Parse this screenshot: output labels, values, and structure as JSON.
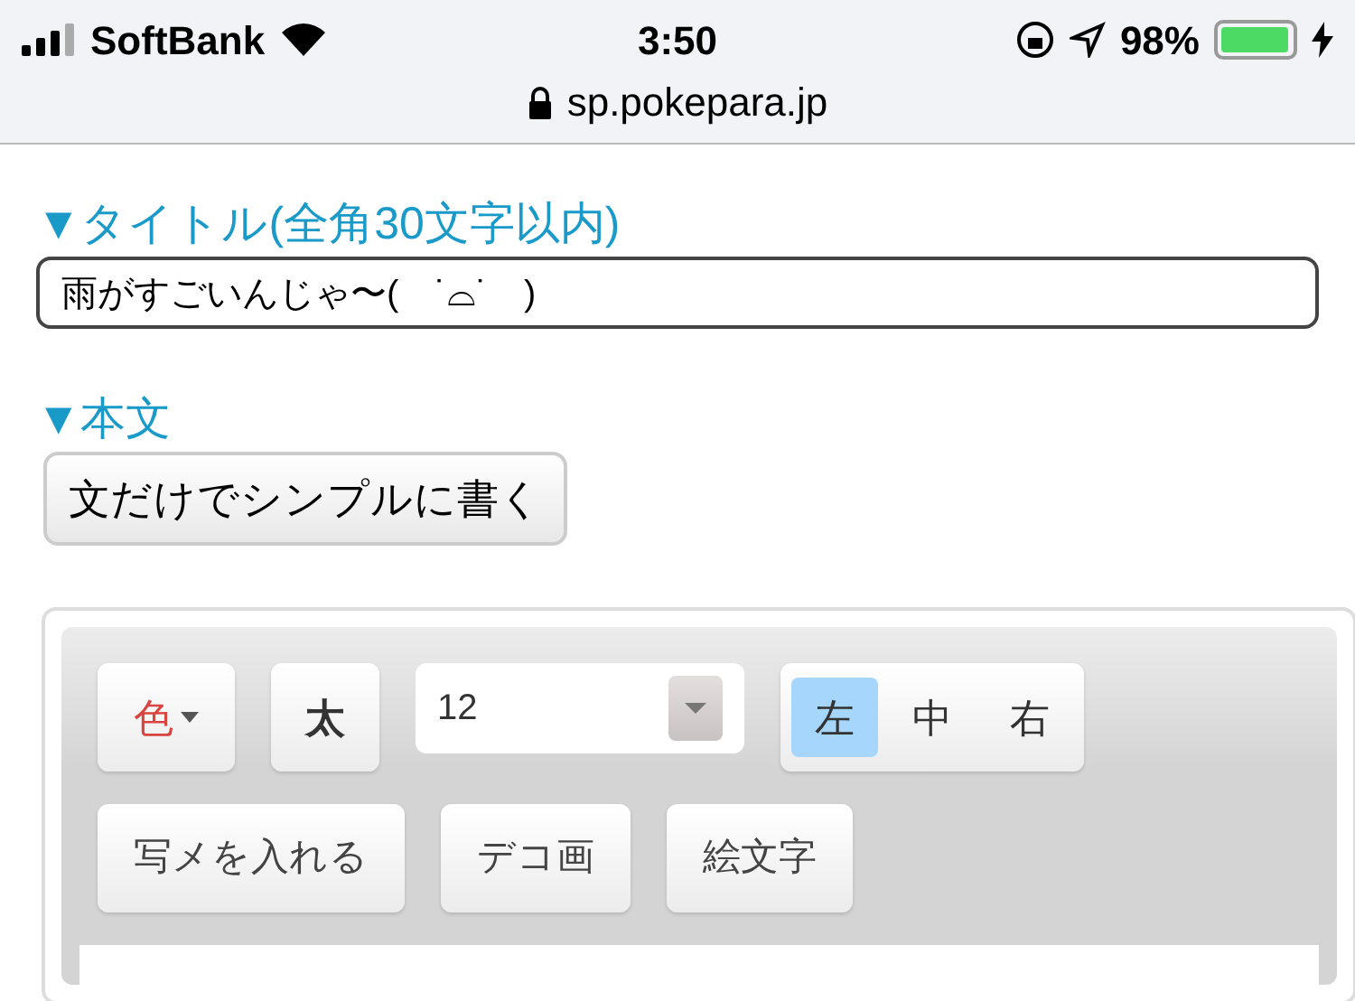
{
  "status_bar": {
    "carrier": "SoftBank",
    "time": "3:50",
    "battery": "98%",
    "url": "sp.pokepara.jp"
  },
  "title_section": {
    "heading": "▼タイトル(全角30文字以内)",
    "value": "雨がすごいんじゃ〜(　˙⌓˙　)"
  },
  "body_section": {
    "heading": "▼本文",
    "simple_button": "文だけでシンプルに書く"
  },
  "toolbar": {
    "color_button": "色",
    "bold_button": "太",
    "font_size": "12",
    "align": [
      {
        "label": "左",
        "selected": true
      },
      {
        "label": "中",
        "selected": false
      },
      {
        "label": "右",
        "selected": false
      }
    ],
    "insert_buttons": [
      "写メを入れる",
      "デコ画",
      "絵文字"
    ]
  }
}
